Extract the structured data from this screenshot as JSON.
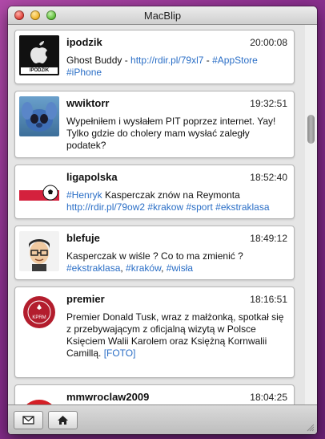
{
  "window": {
    "title": "MacBlip"
  },
  "posts": [
    {
      "user": "ipodzik",
      "time": "20:00:08",
      "avatar": "apple-logo-ipodzik",
      "avatar_label": "IPODZIK",
      "message": [
        {
          "t": "Ghost Buddy - "
        },
        {
          "t": "http://rdir.pl/79xl7",
          "link": true
        },
        {
          "t": " - "
        },
        {
          "t": "#AppStore",
          "link": true
        },
        {
          "t": " "
        },
        {
          "t": "#iPhone",
          "link": true
        }
      ]
    },
    {
      "user": "wwiktorr",
      "time": "19:32:51",
      "avatar": "stitch-cartoon",
      "message": [
        {
          "t": "Wypełniłem i wysłałem PIT poprzez internet. Yay! Tylko gdzie do cholery mam wysłać zaległy podatek?"
        }
      ]
    },
    {
      "user": "ligapolska",
      "time": "18:52:40",
      "avatar": "polish-flag-football",
      "message": [
        {
          "t": "#Henryk",
          "link": true
        },
        {
          "t": " Kasperczak znów na Reymonta "
        },
        {
          "t": "http://rdir.pl/79ow2",
          "link": true
        },
        {
          "t": " "
        },
        {
          "t": "#krakow",
          "link": true
        },
        {
          "t": " "
        },
        {
          "t": "#sport",
          "link": true
        },
        {
          "t": " "
        },
        {
          "t": "#ekstraklasa",
          "link": true
        }
      ]
    },
    {
      "user": "blefuje",
      "time": "18:49:12",
      "avatar": "cartoon-man-glasses",
      "message": [
        {
          "t": "Kasperczak w wiśle ? Co to ma zmienić ? "
        },
        {
          "t": "#ekstraklasa",
          "link": true
        },
        {
          "t": ", "
        },
        {
          "t": "#kraków",
          "link": true
        },
        {
          "t": ", "
        },
        {
          "t": "#wisła",
          "link": true
        }
      ]
    },
    {
      "user": "premier",
      "time": "18:16:51",
      "avatar": "kprm-emblem",
      "avatar_label": "KPRM",
      "message": [
        {
          "t": "Premier Donald Tusk, wraz z małżonką, spotkał się z przebywającym z oficjalną wizytą w Polsce Księciem Walii Karolem oraz Księżną Kornwalii Camillą. "
        },
        {
          "t": "[FOTO]",
          "link": true
        }
      ]
    },
    {
      "user": "mmwroclaw2009",
      "time": "18:04:25",
      "avatar": "red-logo",
      "message": []
    }
  ],
  "toolbar": {
    "compose_icon": "envelope-icon",
    "home_icon": "home-icon"
  },
  "colors": {
    "link": "#2a6ec6",
    "desktop": "#8a2f8e"
  }
}
